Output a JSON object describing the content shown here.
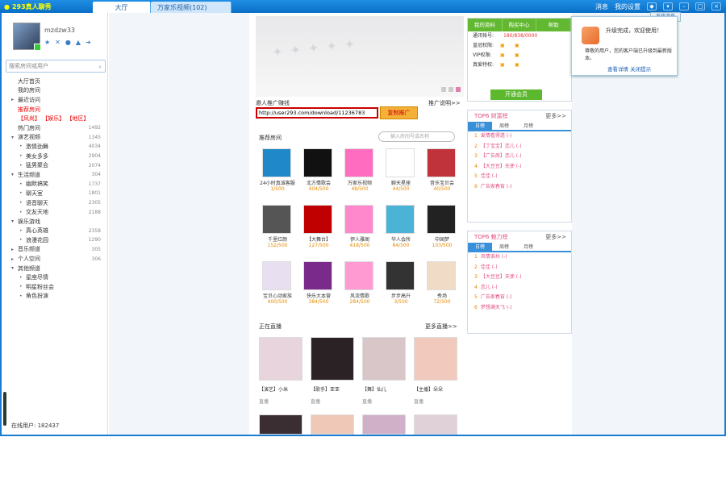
{
  "titlebar": {
    "app_name": "293真人聊秀",
    "tabs": [
      "大厅",
      "万家乐视频(102)"
    ],
    "right": [
      "消息",
      "我的设置"
    ]
  },
  "profile": {
    "username": "mzdzw33"
  },
  "search": {
    "placeholder": "搜索房间或用户"
  },
  "tree": [
    {
      "label": "大厅首页",
      "level": 1,
      "count": ""
    },
    {
      "label": "我的房间",
      "level": 1,
      "count": ""
    },
    {
      "label": "最近访问",
      "level": 1,
      "count": "",
      "arrow": "▸"
    },
    {
      "label": "推荐房间",
      "level": 1,
      "count": "",
      "red": true
    },
    {
      "label": "【风尚】 【娱乐】 【地区】",
      "level": 1,
      "count": "",
      "red": true
    },
    {
      "label": "热门房间",
      "level": 1,
      "count": "1492"
    },
    {
      "label": "演艺视频",
      "level": 1,
      "count": "1345",
      "arrow": "▾"
    },
    {
      "label": "激情劲舞",
      "level": 2,
      "count": "4034"
    },
    {
      "label": "美女多多",
      "level": 2,
      "count": "2904"
    },
    {
      "label": "猛男聚会",
      "level": 2,
      "count": "2074"
    },
    {
      "label": "生活频道",
      "level": 1,
      "count": "304",
      "arrow": "▾"
    },
    {
      "label": "幽默搞笑",
      "level": 2,
      "count": "1737"
    },
    {
      "label": "聊天室",
      "level": 2,
      "count": "1801"
    },
    {
      "label": "语音聊天",
      "level": 2,
      "count": "2305"
    },
    {
      "label": "交友天地",
      "level": 2,
      "count": "2188"
    },
    {
      "label": "娱乐游戏",
      "level": 1,
      "count": "",
      "arrow": "▾"
    },
    {
      "label": "真心英雄",
      "level": 2,
      "count": "2358"
    },
    {
      "label": "浪漫花园",
      "level": 2,
      "count": "1290"
    },
    {
      "label": "音乐频道",
      "level": 1,
      "count": "305",
      "arrow": "▸"
    },
    {
      "label": "个人空间",
      "level": 1,
      "count": "306",
      "arrow": "▸"
    },
    {
      "label": "其他频道",
      "level": 1,
      "count": "",
      "arrow": "▾"
    },
    {
      "label": "星座尽情",
      "level": 2,
      "count": ""
    },
    {
      "label": "明星粉丝会",
      "level": 2,
      "count": ""
    },
    {
      "label": "角色扮演",
      "level": 2,
      "count": ""
    }
  ],
  "left_footer": "在线用户: 182437",
  "promo": {
    "title": "邀人推广赚钱",
    "more": "推广说明>>",
    "url": "http://user293.com/download/11236783",
    "button": "复制推广"
  },
  "recommend": {
    "title": "推荐房间",
    "search_placeholder": "输入房间号或名称",
    "rooms": [
      {
        "name": "24小时真诚客服",
        "count": "1/500",
        "bg": "#1e88c8"
      },
      {
        "name": "北方情歌会",
        "count": "404/500",
        "bg": "#111"
      },
      {
        "name": "万家乐视频",
        "count": "48/500",
        "bg": "#ff6cc0"
      },
      {
        "name": "聊天星座",
        "count": "44/500",
        "bg": "#ffffff"
      },
      {
        "name": "音乐宝贝会",
        "count": "40/500",
        "bg": "#c0333a"
      },
      {
        "name": "千里红颜",
        "count": "152/500",
        "bg": "#555"
      },
      {
        "name": "【大舞台】",
        "count": "127/500",
        "bg": "#c00000"
      },
      {
        "name": "伊人雅阁",
        "count": "418/500",
        "bg": "#ff88cc"
      },
      {
        "name": "华人会所",
        "count": "84/500",
        "bg": "#4ab3d6"
      },
      {
        "name": "中国梦",
        "count": "103/500",
        "bg": "#222"
      },
      {
        "name": "宝贝心动家族",
        "count": "400/500",
        "bg": "#e8e0f0"
      },
      {
        "name": "快乐大本营",
        "count": "384/500",
        "bg": "#7a2a8a"
      },
      {
        "name": "风流情歌",
        "count": "284/500",
        "bg": "#ff9ad2"
      },
      {
        "name": "步步高升",
        "count": "3/500",
        "bg": "#333"
      },
      {
        "name": "秀场",
        "count": "72/500",
        "bg": "#f0dcc6"
      }
    ]
  },
  "live": {
    "title": "正在直播",
    "more": "更多直播>>",
    "hosts": [
      {
        "name": "【演艺】小米",
        "status": "直播"
      },
      {
        "name": "【歌手】亚亚",
        "status": "直播"
      },
      {
        "name": "【舞】仙儿",
        "status": "直播"
      },
      {
        "name": "【主播】朵朵",
        "status": "直播"
      }
    ]
  },
  "info": {
    "tabs": [
      "我的资料",
      "购买中心",
      "帮助"
    ],
    "rows": [
      {
        "label": "通讯帐号:",
        "value": "180/838/0000"
      },
      {
        "label": "皇冠权限:",
        "value": ""
      },
      {
        "label": "VIP权限:",
        "value": ""
      },
      {
        "label": "真爱特权:",
        "value": ""
      }
    ],
    "button": "开通会员"
  },
  "top_rich": {
    "title": "TOP6 财富榜",
    "more": "更多>>",
    "tabs": [
      "日榜",
      "周榜",
      "月榜"
    ],
    "items": [
      "爱情看得透 (-)",
      "【丁宝宝】恋儿 (-)",
      "【广告商】恋儿 (-)",
      "【大豆豆】天使 (-)",
      "佳佳 (-)",
      "广告家春宵 (-)"
    ]
  },
  "top_charm": {
    "title": "TOP6 魅力榜",
    "more": "更多>>",
    "tabs": [
      "日榜",
      "周榜",
      "月榜"
    ],
    "items": [
      "风情谁共 (-)",
      "佳佳 (-)",
      "【大豆豆】天使 (-)",
      "恋儿 (-)",
      "广告家春宵 (-)",
      "梦想满天飞 (-)"
    ]
  },
  "notify": {
    "tab": "系统消息",
    "title": "升级完成，欢迎使用！",
    "body": "尊敬的用户，您的客户端已升级到最新版本。",
    "link": "查看详情  关闭提示"
  }
}
